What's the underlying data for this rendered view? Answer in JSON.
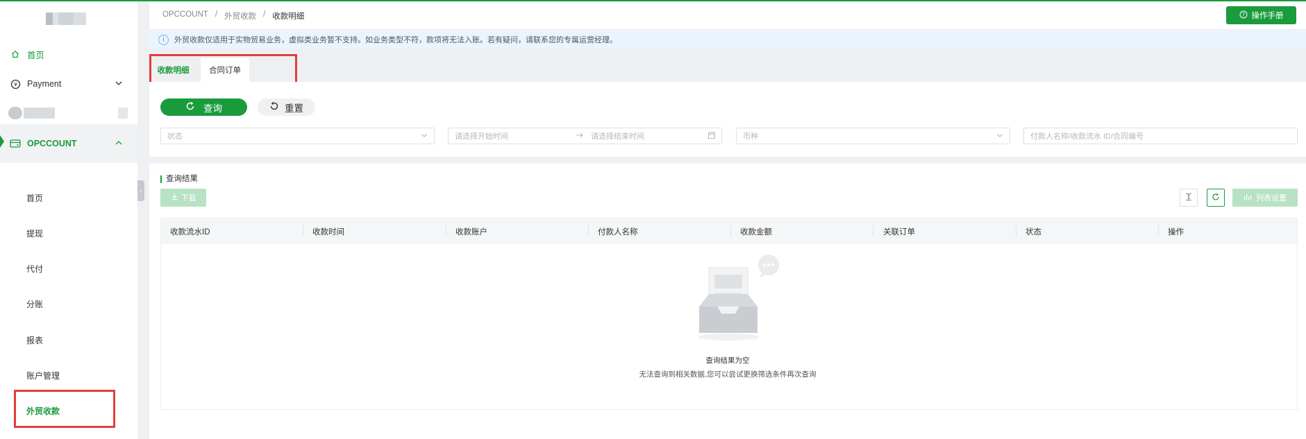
{
  "sidebar": {
    "home": "首页",
    "payment": "Payment",
    "opccount": "OPCCOUNT",
    "sub_items": [
      "首页",
      "提现",
      "代付",
      "分账",
      "报表",
      "账户管理",
      "外贸收款"
    ]
  },
  "header": {
    "breadcrumb": [
      "OPCCOUNT",
      "外贸收款",
      "收款明细"
    ],
    "separator": "/",
    "manual_button": "操作手册"
  },
  "notice": {
    "text": "外贸收款仅适用于实物贸易业务，虚拟类业务暂不支持。如业务类型不符，款项将无法入账。若有疑问，请联系您的专属运营经理。"
  },
  "tabs": [
    "收款明细",
    "合同订单"
  ],
  "filters": {
    "query_button": "查询",
    "reset_button": "重置",
    "status_placeholder": "状态",
    "start_date_placeholder": "请选择开始时间",
    "end_date_placeholder": "请选择结束时间",
    "currency_placeholder": "币种",
    "keyword_placeholder": "付款人名称/收款流水 ID/合同编号"
  },
  "results": {
    "title": "查询结果",
    "download_button": "下载",
    "column_settings_button": "列表设置",
    "columns": [
      "收款流水ID",
      "收款时间",
      "收款账户",
      "付款人名称",
      "收款金额",
      "关联订单",
      "状态",
      "操作"
    ],
    "empty_title": "查询结果为空",
    "empty_desc": "无法查询到相关数据,您可以尝试更换筛选条件再次查询"
  },
  "colors": {
    "accent": "#1a9b3c",
    "highlight_box": "#e23d3d"
  }
}
